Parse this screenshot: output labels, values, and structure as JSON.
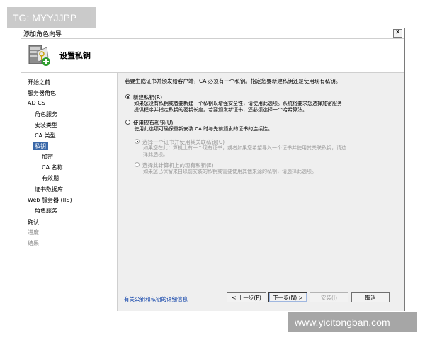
{
  "watermarks": {
    "top_left": "TG: MYYJJPP",
    "bottom_right": "www.yicitongban.com"
  },
  "window": {
    "title": "添加角色向导",
    "close_symbol": "✕"
  },
  "header": {
    "title": "设置私钥",
    "icon": "server-key-icon"
  },
  "sidebar": {
    "items": [
      {
        "label": "开始之前",
        "state": "normal"
      },
      {
        "label": "服务器角色",
        "state": "normal"
      },
      {
        "label": "AD CS",
        "state": "normal"
      },
      {
        "label": "角色服务",
        "state": "normal"
      },
      {
        "label": "安装类型",
        "state": "normal"
      },
      {
        "label": "CA 类型",
        "state": "normal"
      },
      {
        "label": "私钥",
        "state": "selected"
      },
      {
        "label": "加密",
        "state": "normal"
      },
      {
        "label": "CA 名称",
        "state": "normal"
      },
      {
        "label": "有效期",
        "state": "normal"
      },
      {
        "label": "证书数据库",
        "state": "normal"
      },
      {
        "label": "Web 服务器 (IIS)",
        "state": "normal"
      },
      {
        "label": "角色服务",
        "state": "normal"
      },
      {
        "label": "确认",
        "state": "normal"
      },
      {
        "label": "进度",
        "state": "disabled"
      },
      {
        "label": "结果",
        "state": "disabled"
      }
    ]
  },
  "content": {
    "intro": "若要生成证书并颁发给客户端，CA 必须有一个私钥。指定您要新建私钥还是使用现有私钥。",
    "option_new": {
      "label": "新建私钥(R)",
      "desc1": "如果您没有私钥或者要新建一个私钥以增强安全性，请使用此选项。系统将要求您选择加密服务",
      "desc2": "提供程序并指定私钥的密钥长度。若要颁发新证书，还必须选择一个哈希算法。",
      "checked": true
    },
    "option_existing": {
      "label": "使用现有私钥(U)",
      "desc": "使用此选项可确保重新安装 CA 时与先前颁发的证书的连续性。",
      "checked": false
    },
    "sub_cert": {
      "label": "选择一个证书并使用其关联私钥(C)",
      "desc1": "如果您在此计算机上有一个现有证书，或者如果您希望导入一个证书并使用其关联私钥，请选",
      "desc2": "择此选项。",
      "checked": true
    },
    "sub_key": {
      "label": "选择此计算机上的现有私钥(E)",
      "desc": "如果您已保留来自以前安装的私钥或需要使用其他来源的私钥，请选择此选项。",
      "checked": false
    },
    "more_info_link": "有关公钥和私钥的详细信息"
  },
  "buttons": {
    "previous": "< 上一步(P)",
    "next": "下一步(N) >",
    "install": "安装(I)",
    "cancel": "取消"
  }
}
